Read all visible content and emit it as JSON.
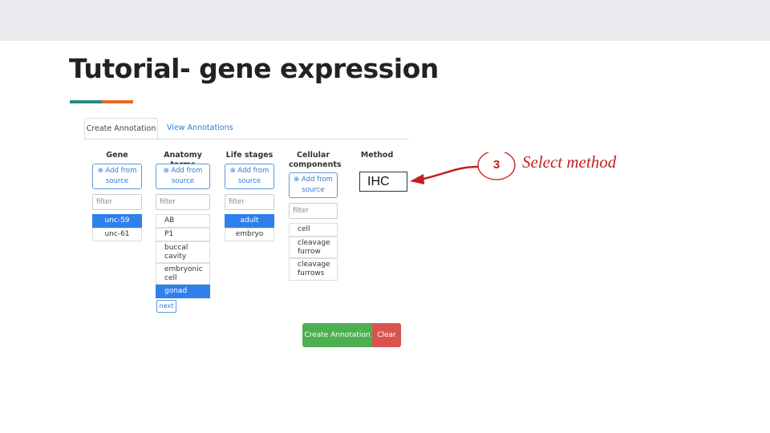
{
  "slide": {
    "title": "Tutorial- gene expression",
    "accent_colors": [
      "#2a8a86",
      "#e2692a"
    ]
  },
  "tabs": [
    {
      "label": "Create Annotation",
      "active": true
    },
    {
      "label": "View Annotations",
      "active": false
    }
  ],
  "columns": {
    "gene": {
      "heading": "Gene",
      "add_label": "⊕ Add from source",
      "filter_placeholder": "filter",
      "items": [
        {
          "label": "unc-59",
          "selected": true
        },
        {
          "label": "unc-61",
          "selected": false
        }
      ]
    },
    "anatomy": {
      "heading": "Anatomy terms",
      "add_label": "⊕ Add from source",
      "filter_placeholder": "filter",
      "items": [
        {
          "label": "AB",
          "selected": false
        },
        {
          "label": "P1",
          "selected": false
        },
        {
          "label": "buccal cavity",
          "selected": false
        },
        {
          "label": "embryonic cell",
          "selected": false
        },
        {
          "label": "gonad",
          "selected": true
        }
      ],
      "next_label": "next"
    },
    "life_stages": {
      "heading": "Life stages",
      "add_label": "⊕ Add from source",
      "filter_placeholder": "filter",
      "items": [
        {
          "label": "adult",
          "selected": true
        },
        {
          "label": "embryo",
          "selected": false
        }
      ]
    },
    "cellular": {
      "heading": "Cellular components",
      "add_label": "⊕ Add from source",
      "filter_placeholder": "filter",
      "items": [
        {
          "label": "cell",
          "selected": false
        },
        {
          "label": "cleavage furrow",
          "selected": false
        },
        {
          "label": "cleavage furrows",
          "selected": false
        }
      ]
    },
    "method": {
      "heading": "Method",
      "value": "IHC"
    }
  },
  "actions": {
    "create_label": "Create Annotation",
    "clear_label": "Clear"
  },
  "callout": {
    "step": "3",
    "text": "Select method",
    "color": "#c41e1e"
  }
}
